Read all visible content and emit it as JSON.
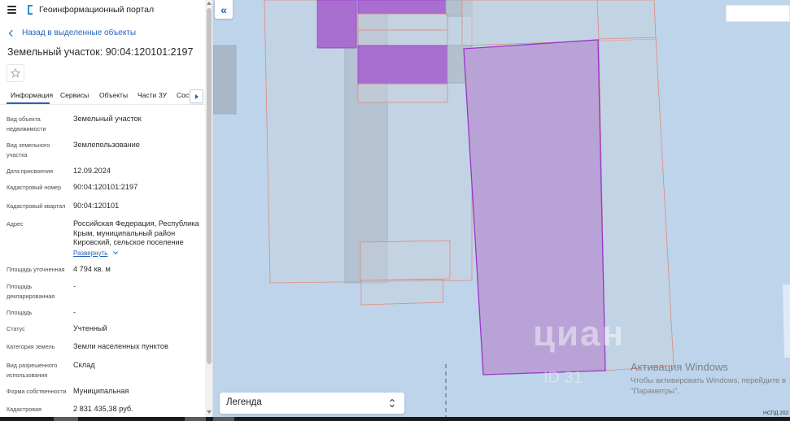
{
  "header": {
    "app_title": "Геоинформационный портал",
    "menu_icon": "hamburger-menu-icon",
    "logo_icon": "portal-logo-icon"
  },
  "nav": {
    "back_label": "Назад в выделенные объекты"
  },
  "object": {
    "title": "Земельный участок: 90:04:120101:2197"
  },
  "tabs": [
    {
      "label": "Информация",
      "active": true
    },
    {
      "label": "Сервисы"
    },
    {
      "label": "Объекты"
    },
    {
      "label": "Части ЗУ"
    },
    {
      "label": "Сост"
    }
  ],
  "info": {
    "rows": [
      {
        "label": "Вид объекта недвижимости",
        "value": "Земельный участок"
      },
      {
        "label": "Вид земельного участка",
        "value": "Землепользование"
      },
      {
        "label": "Дата присвоения",
        "value": "12.09.2024"
      },
      {
        "label": "Кадастровый номер",
        "value": "90:04:120101:2197"
      },
      {
        "label": "Кадастровый квартал",
        "value": "90:04:120101"
      },
      {
        "label": "Адрес",
        "value": "Российская Федерация, Республика Крым, муниципальный район Кировский, сельское поселение"
      },
      {
        "label": "Площадь уточненная",
        "value": "4 794 кв. м"
      },
      {
        "label": "Площадь декларированная",
        "value": "-"
      },
      {
        "label": "Площадь",
        "value": "-"
      },
      {
        "label": "Статус",
        "value": "Учтенный"
      },
      {
        "label": "Категория земель",
        "value": "Земли населенных пунктов"
      },
      {
        "label": "Вид разрешенного использования",
        "value": "Склад"
      },
      {
        "label": "Форма собственности",
        "value": "Муниципальная"
      },
      {
        "label": "Кадастровая",
        "value": "2 831 435,38 руб."
      }
    ],
    "expand_label": "Развернуть"
  },
  "map": {
    "legend_label": "Легенда",
    "attribution": "НСПД 202",
    "watermark": "циан",
    "watermark_id": "ID 31",
    "activation_title": "Активация Windows",
    "activation_line1": "Чтобы активировать Windows, перейдите в",
    "activation_line2": "\"Параметры\".",
    "colors": {
      "water": "#bdd4ea",
      "parcel_outline": "#e08a7a",
      "selected_fill": "#b9a3d6",
      "selected_stroke": "#9b35c9",
      "purple_block": "#a86fd0"
    }
  }
}
